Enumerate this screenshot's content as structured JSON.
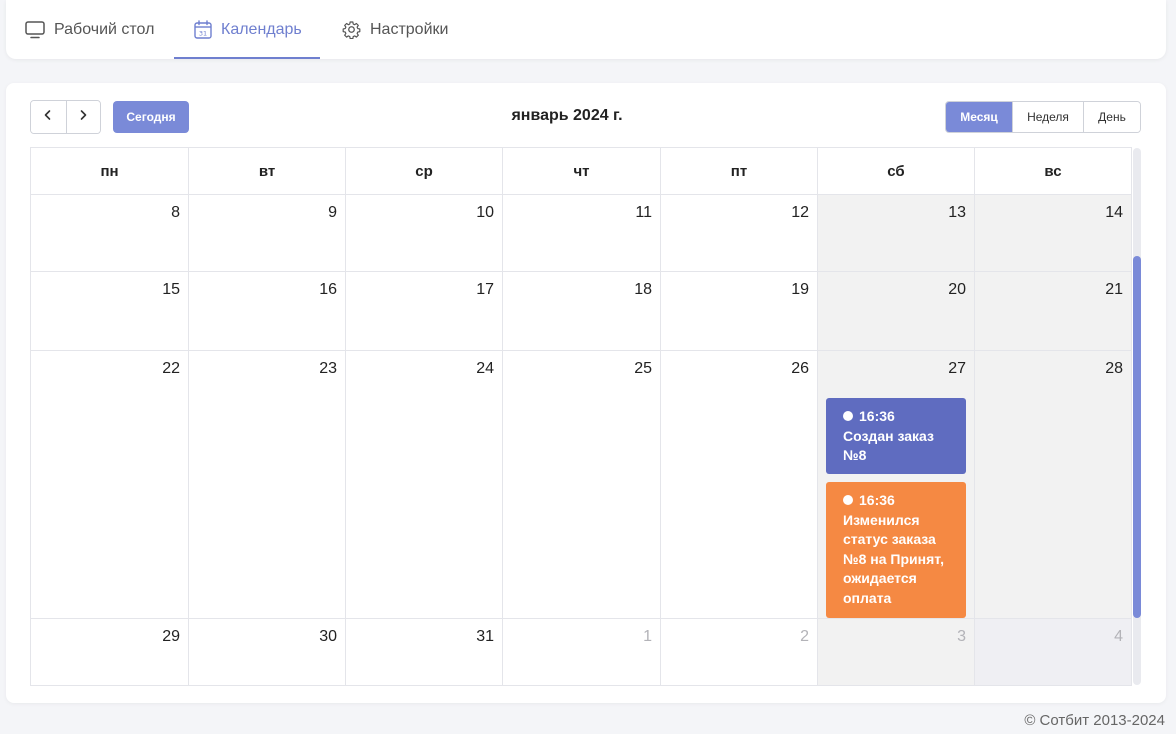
{
  "tabs": [
    {
      "label": "Рабочий стол",
      "icon": "monitor-icon"
    },
    {
      "label": "Календарь",
      "icon": "calendar-icon",
      "icon_text": "31"
    },
    {
      "label": "Настройки",
      "icon": "gear-icon"
    }
  ],
  "calendar": {
    "today_label": "Сегодня",
    "title": "январь 2024 г.",
    "views": [
      "Месяц",
      "Неделя",
      "День"
    ],
    "active_view": "Месяц",
    "weekdays": [
      "пн",
      "вт",
      "ср",
      "чт",
      "пт",
      "сб",
      "вс"
    ],
    "weeks": [
      [
        "8",
        "9",
        "10",
        "11",
        "12",
        "13",
        "14"
      ],
      [
        "15",
        "16",
        "17",
        "18",
        "19",
        "20",
        "21"
      ],
      [
        "22",
        "23",
        "24",
        "25",
        "26",
        "27",
        "28"
      ],
      [
        "29",
        "30",
        "31",
        "1",
        "2",
        "3",
        "4"
      ]
    ],
    "events": [
      {
        "time": "16:36",
        "title": "Создан заказ №8",
        "color": "#5f6cc0"
      },
      {
        "time": "16:36",
        "title": "Изменился статус заказа №8 на Принят, ожидается оплата",
        "color": "#f58943"
      }
    ]
  },
  "footer": {
    "copyright": "© Сотбит 2013-2024"
  },
  "colors": {
    "accent": "#7a8ad8",
    "event_blue": "#5f6cc0",
    "event_orange": "#f58943"
  }
}
